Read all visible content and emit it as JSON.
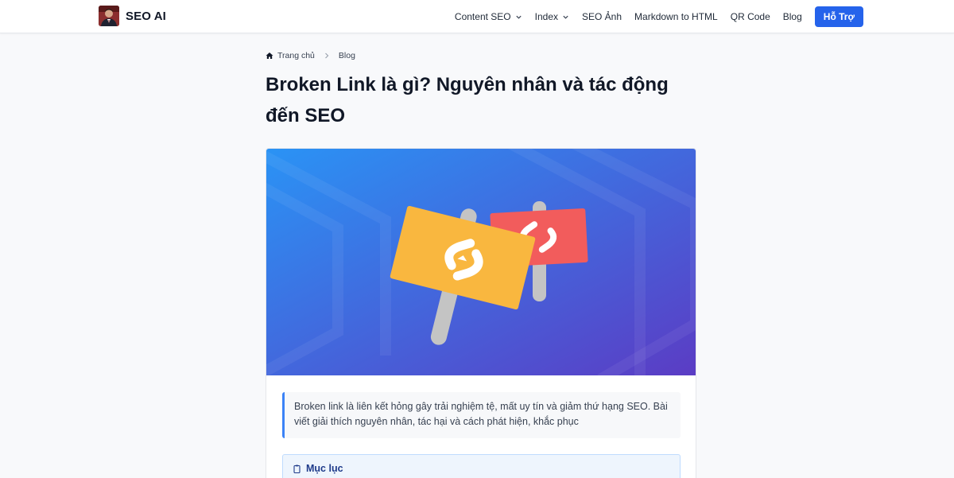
{
  "header": {
    "brand": "SEO AI",
    "nav": [
      {
        "label": "Content SEO",
        "dropdown": true
      },
      {
        "label": "Index",
        "dropdown": true
      },
      {
        "label": "SEO Ảnh",
        "dropdown": false
      },
      {
        "label": "Markdown to HTML",
        "dropdown": false
      },
      {
        "label": "QR Code",
        "dropdown": false
      },
      {
        "label": "Blog",
        "dropdown": false
      }
    ],
    "cta": "Hỗ Trợ"
  },
  "breadcrumb": {
    "home": "Trang chủ",
    "current": "Blog"
  },
  "article": {
    "title": "Broken Link là gì? Nguyên nhân và tác động đến SEO",
    "summary": "Broken link là liên kết hỏng gây trải nghiệm tệ, mất uy tín và giảm thứ hạng SEO. Bài viết giải thích nguyên nhân, tác hại và cách phát hiện, khắc phục",
    "toc_title": "Mục lục"
  },
  "colors": {
    "accent": "#2563eb",
    "hero_gradient_start": "#2a93f5",
    "hero_gradient_end": "#5b3cc4",
    "sign_yellow": "#f9b73f",
    "sign_red": "#f25c5c"
  },
  "icons": {
    "home": "home-icon",
    "separator": "chevron-right-icon",
    "dropdown": "chevron-down-icon",
    "toc": "clipboard-icon",
    "hero": "broken-link-signs-illustration"
  }
}
